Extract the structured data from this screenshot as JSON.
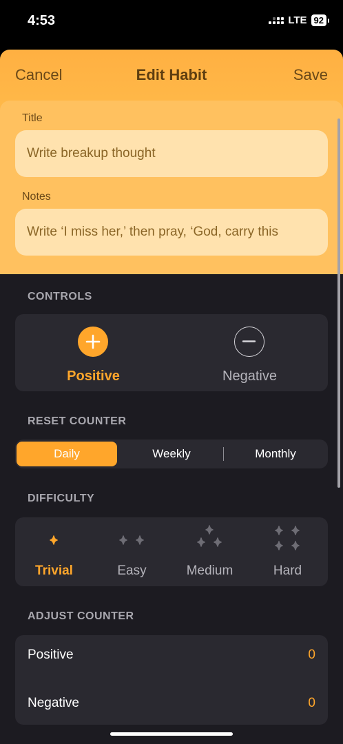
{
  "status": {
    "time": "4:53",
    "network": "LTE",
    "battery": "92"
  },
  "nav": {
    "cancel": "Cancel",
    "title": "Edit Habit",
    "save": "Save"
  },
  "form": {
    "title_label": "Title",
    "title_value": "Write breakup thought",
    "notes_label": "Notes",
    "notes_value": "Write ‘I miss her,’ then pray, ‘God, carry this"
  },
  "controls": {
    "header": "CONTROLS",
    "positive": "Positive",
    "negative": "Negative",
    "selected": "Positive"
  },
  "reset_counter": {
    "header": "RESET COUNTER",
    "options": [
      "Daily",
      "Weekly",
      "Monthly"
    ],
    "selected": "Daily"
  },
  "difficulty": {
    "header": "DIFFICULTY",
    "options": [
      "Trivial",
      "Easy",
      "Medium",
      "Hard"
    ],
    "selected": "Trivial"
  },
  "adjust_counter": {
    "header": "ADJUST COUNTER",
    "rows": [
      {
        "label": "Positive",
        "value": "0"
      },
      {
        "label": "Negative",
        "value": "0"
      }
    ]
  },
  "colors": {
    "accent": "#ffa62b",
    "header_bg": "#ffb848",
    "input_bg": "#ffe2ae",
    "dark_bg": "#1c1b21",
    "card_bg": "#2a2930"
  }
}
